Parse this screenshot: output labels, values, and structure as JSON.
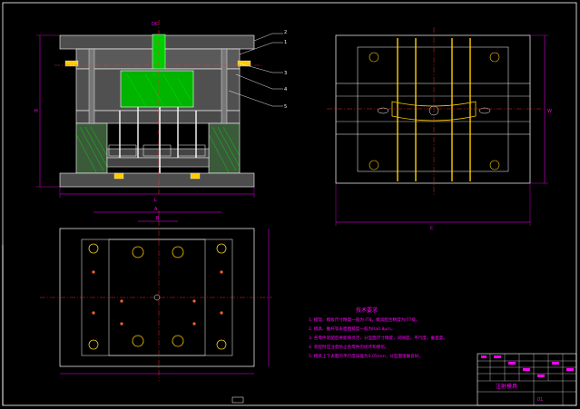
{
  "drawing": {
    "colors": {
      "background": "#000000",
      "outline": "#ffffff",
      "dimension": "#ff00ff",
      "center": "#ff3030",
      "plate_fill": "#5a5a5a",
      "core_fill": "#00cc00",
      "hatch": "#00ff00",
      "bolt": "#ffff00",
      "leader": "#ffffff"
    },
    "callouts": [
      "2",
      "1",
      "3",
      "4",
      "5"
    ],
    "dims": {
      "top_label": "DC",
      "left_height": "H",
      "bottom_width": "L",
      "plan_width": "A",
      "plan_inner": "B",
      "right_height": "W",
      "right_bottom": "C"
    },
    "notes": {
      "title": "技术要求",
      "lines": [
        "1. 模架、模板尺寸精度一般为 IT8，模具配合精度为IT7级。",
        "2. 模具、推杆等表面粗糙度一般为Ra0.8μm。",
        "3. 各零件装配后要能够灵活，分型面尺寸精度，间隙度，平行度，垂直度。",
        "4. 装配时应注意防止各零件的损坏和擦伤。",
        "5. 模具上下表面的平行度误差为0.05mm，分型面接触良好。"
      ]
    },
    "title_block": {
      "name": "注射模具",
      "drawing_no": "01"
    }
  }
}
